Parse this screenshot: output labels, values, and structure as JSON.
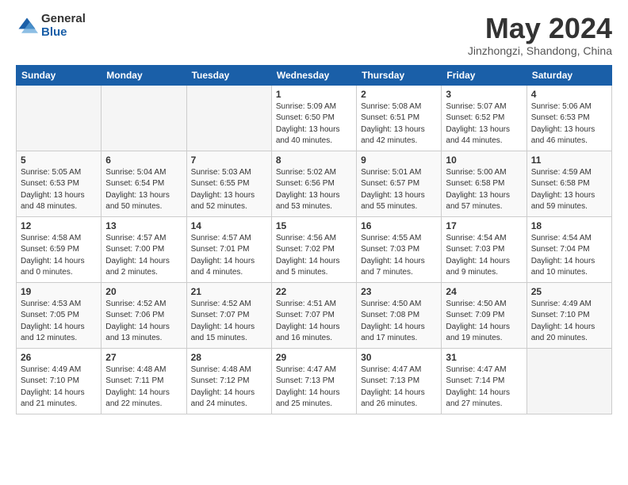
{
  "logo": {
    "general": "General",
    "blue": "Blue"
  },
  "title": "May 2024",
  "location": "Jinzhongzi, Shandong, China",
  "days_of_week": [
    "Sunday",
    "Monday",
    "Tuesday",
    "Wednesday",
    "Thursday",
    "Friday",
    "Saturday"
  ],
  "weeks": [
    [
      {
        "day": "",
        "info": ""
      },
      {
        "day": "",
        "info": ""
      },
      {
        "day": "",
        "info": ""
      },
      {
        "day": "1",
        "info": "Sunrise: 5:09 AM\nSunset: 6:50 PM\nDaylight: 13 hours\nand 40 minutes."
      },
      {
        "day": "2",
        "info": "Sunrise: 5:08 AM\nSunset: 6:51 PM\nDaylight: 13 hours\nand 42 minutes."
      },
      {
        "day": "3",
        "info": "Sunrise: 5:07 AM\nSunset: 6:52 PM\nDaylight: 13 hours\nand 44 minutes."
      },
      {
        "day": "4",
        "info": "Sunrise: 5:06 AM\nSunset: 6:53 PM\nDaylight: 13 hours\nand 46 minutes."
      }
    ],
    [
      {
        "day": "5",
        "info": "Sunrise: 5:05 AM\nSunset: 6:53 PM\nDaylight: 13 hours\nand 48 minutes."
      },
      {
        "day": "6",
        "info": "Sunrise: 5:04 AM\nSunset: 6:54 PM\nDaylight: 13 hours\nand 50 minutes."
      },
      {
        "day": "7",
        "info": "Sunrise: 5:03 AM\nSunset: 6:55 PM\nDaylight: 13 hours\nand 52 minutes."
      },
      {
        "day": "8",
        "info": "Sunrise: 5:02 AM\nSunset: 6:56 PM\nDaylight: 13 hours\nand 53 minutes."
      },
      {
        "day": "9",
        "info": "Sunrise: 5:01 AM\nSunset: 6:57 PM\nDaylight: 13 hours\nand 55 minutes."
      },
      {
        "day": "10",
        "info": "Sunrise: 5:00 AM\nSunset: 6:58 PM\nDaylight: 13 hours\nand 57 minutes."
      },
      {
        "day": "11",
        "info": "Sunrise: 4:59 AM\nSunset: 6:58 PM\nDaylight: 13 hours\nand 59 minutes."
      }
    ],
    [
      {
        "day": "12",
        "info": "Sunrise: 4:58 AM\nSunset: 6:59 PM\nDaylight: 14 hours\nand 0 minutes."
      },
      {
        "day": "13",
        "info": "Sunrise: 4:57 AM\nSunset: 7:00 PM\nDaylight: 14 hours\nand 2 minutes."
      },
      {
        "day": "14",
        "info": "Sunrise: 4:57 AM\nSunset: 7:01 PM\nDaylight: 14 hours\nand 4 minutes."
      },
      {
        "day": "15",
        "info": "Sunrise: 4:56 AM\nSunset: 7:02 PM\nDaylight: 14 hours\nand 5 minutes."
      },
      {
        "day": "16",
        "info": "Sunrise: 4:55 AM\nSunset: 7:03 PM\nDaylight: 14 hours\nand 7 minutes."
      },
      {
        "day": "17",
        "info": "Sunrise: 4:54 AM\nSunset: 7:03 PM\nDaylight: 14 hours\nand 9 minutes."
      },
      {
        "day": "18",
        "info": "Sunrise: 4:54 AM\nSunset: 7:04 PM\nDaylight: 14 hours\nand 10 minutes."
      }
    ],
    [
      {
        "day": "19",
        "info": "Sunrise: 4:53 AM\nSunset: 7:05 PM\nDaylight: 14 hours\nand 12 minutes."
      },
      {
        "day": "20",
        "info": "Sunrise: 4:52 AM\nSunset: 7:06 PM\nDaylight: 14 hours\nand 13 minutes."
      },
      {
        "day": "21",
        "info": "Sunrise: 4:52 AM\nSunset: 7:07 PM\nDaylight: 14 hours\nand 15 minutes."
      },
      {
        "day": "22",
        "info": "Sunrise: 4:51 AM\nSunset: 7:07 PM\nDaylight: 14 hours\nand 16 minutes."
      },
      {
        "day": "23",
        "info": "Sunrise: 4:50 AM\nSunset: 7:08 PM\nDaylight: 14 hours\nand 17 minutes."
      },
      {
        "day": "24",
        "info": "Sunrise: 4:50 AM\nSunset: 7:09 PM\nDaylight: 14 hours\nand 19 minutes."
      },
      {
        "day": "25",
        "info": "Sunrise: 4:49 AM\nSunset: 7:10 PM\nDaylight: 14 hours\nand 20 minutes."
      }
    ],
    [
      {
        "day": "26",
        "info": "Sunrise: 4:49 AM\nSunset: 7:10 PM\nDaylight: 14 hours\nand 21 minutes."
      },
      {
        "day": "27",
        "info": "Sunrise: 4:48 AM\nSunset: 7:11 PM\nDaylight: 14 hours\nand 22 minutes."
      },
      {
        "day": "28",
        "info": "Sunrise: 4:48 AM\nSunset: 7:12 PM\nDaylight: 14 hours\nand 24 minutes."
      },
      {
        "day": "29",
        "info": "Sunrise: 4:47 AM\nSunset: 7:13 PM\nDaylight: 14 hours\nand 25 minutes."
      },
      {
        "day": "30",
        "info": "Sunrise: 4:47 AM\nSunset: 7:13 PM\nDaylight: 14 hours\nand 26 minutes."
      },
      {
        "day": "31",
        "info": "Sunrise: 4:47 AM\nSunset: 7:14 PM\nDaylight: 14 hours\nand 27 minutes."
      },
      {
        "day": "",
        "info": ""
      }
    ]
  ]
}
